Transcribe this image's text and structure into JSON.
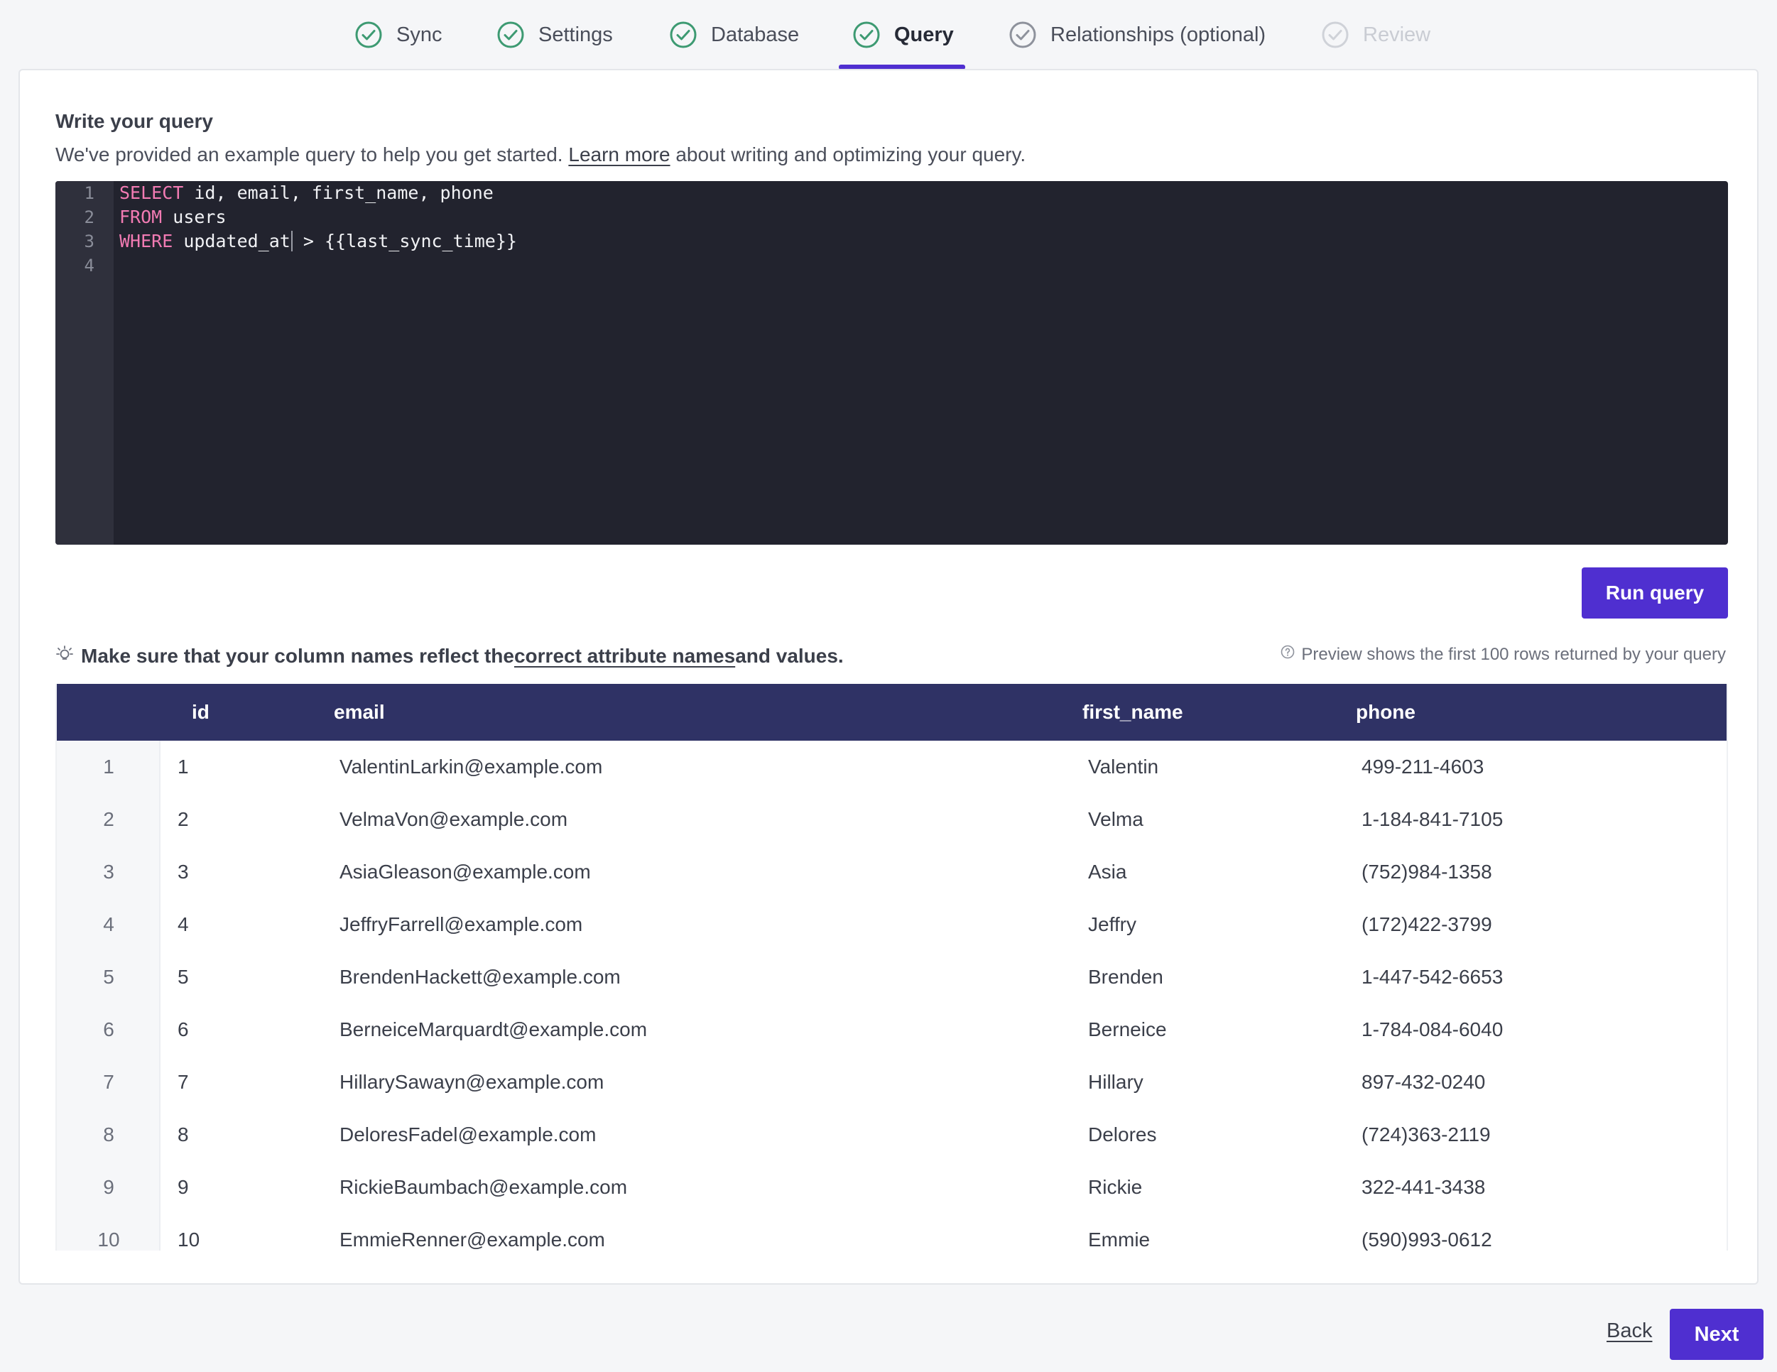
{
  "stepper": {
    "steps": [
      {
        "label": "Sync",
        "state": "complete"
      },
      {
        "label": "Settings",
        "state": "complete"
      },
      {
        "label": "Database",
        "state": "complete"
      },
      {
        "label": "Query",
        "state": "active"
      },
      {
        "label": "Relationships (optional)",
        "state": "pending"
      },
      {
        "label": "Review",
        "state": "disabled"
      }
    ]
  },
  "query_section": {
    "title": "Write your query",
    "desc_before": "We've provided an example query to help you get started. ",
    "desc_link": "Learn more",
    "desc_after": " about writing and optimizing your query."
  },
  "editor": {
    "line_numbers": [
      "1",
      "2",
      "3",
      "4"
    ],
    "lines": [
      {
        "kw": "SELECT",
        "rest": " id, email, first_name, phone"
      },
      {
        "kw": "FROM",
        "rest": " users"
      },
      {
        "kw": "WHERE",
        "rest_a": " updated_at",
        "rest_b": " > {{last_sync_time}}"
      },
      {
        "kw": "",
        "rest": ""
      }
    ]
  },
  "run_button": "Run query",
  "hint": {
    "before": "Make sure that your column names reflect the ",
    "link": "correct attribute names",
    "after": " and values."
  },
  "preview_note": "Preview shows the first 100 rows returned by your query",
  "table": {
    "columns": [
      "id",
      "email",
      "first_name",
      "phone"
    ],
    "rows": [
      {
        "n": "1",
        "id": "1",
        "email": "ValentinLarkin@example.com",
        "first_name": "Valentin",
        "phone": "499-211-4603"
      },
      {
        "n": "2",
        "id": "2",
        "email": "VelmaVon@example.com",
        "first_name": "Velma",
        "phone": "1-184-841-7105"
      },
      {
        "n": "3",
        "id": "3",
        "email": "AsiaGleason@example.com",
        "first_name": "Asia",
        "phone": "(752)984-1358"
      },
      {
        "n": "4",
        "id": "4",
        "email": "JeffryFarrell@example.com",
        "first_name": "Jeffry",
        "phone": "(172)422-3799"
      },
      {
        "n": "5",
        "id": "5",
        "email": "BrendenHackett@example.com",
        "first_name": "Brenden",
        "phone": "1-447-542-6653"
      },
      {
        "n": "6",
        "id": "6",
        "email": "BerneiceMarquardt@example.com",
        "first_name": "Berneice",
        "phone": "1-784-084-6040"
      },
      {
        "n": "7",
        "id": "7",
        "email": "HillarySawayn@example.com",
        "first_name": "Hillary",
        "phone": "897-432-0240"
      },
      {
        "n": "8",
        "id": "8",
        "email": "DeloresFadel@example.com",
        "first_name": "Delores",
        "phone": "(724)363-2119"
      },
      {
        "n": "9",
        "id": "9",
        "email": "RickieBaumbach@example.com",
        "first_name": "Rickie",
        "phone": "322-441-3438"
      },
      {
        "n": "10",
        "id": "10",
        "email": "EmmieRenner@example.com",
        "first_name": "Emmie",
        "phone": "(590)993-0612"
      }
    ]
  },
  "footer": {
    "back": "Back",
    "next": "Next"
  },
  "colors": {
    "accent": "#4f2fd0",
    "check_complete": "#3d9a72",
    "check_pending": "#8e929c",
    "table_header": "#2f3265",
    "editor_bg": "#22232e",
    "keyword": "#f27bb3"
  }
}
